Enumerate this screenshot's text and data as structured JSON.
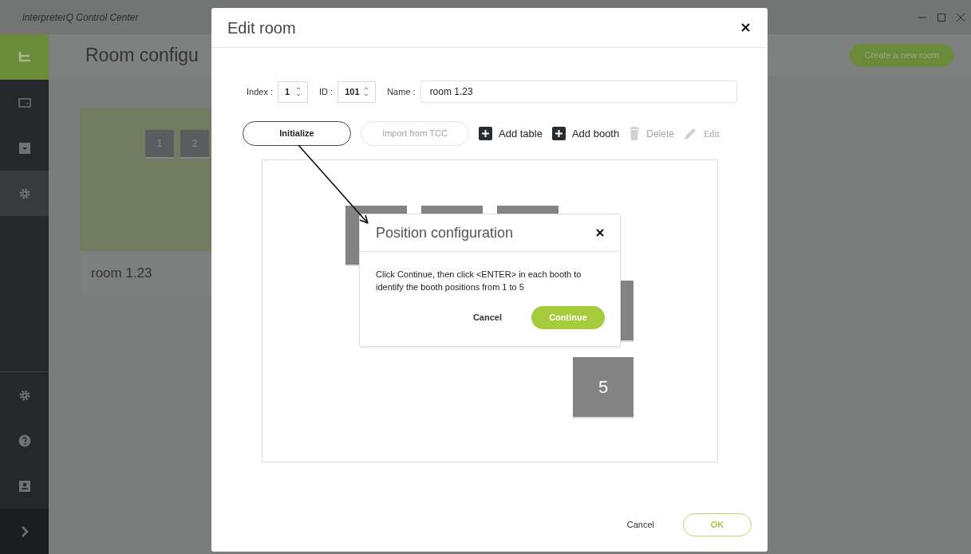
{
  "window": {
    "title": "interpreterQ Control Center"
  },
  "page": {
    "title": "Room configu",
    "create_button": "Create a new room"
  },
  "sidebar": {
    "items": [
      {
        "selected": false
      },
      {
        "selected": false
      },
      {
        "selected": true
      }
    ]
  },
  "room_card": {
    "name": "room 1.23",
    "booths": [
      "1",
      "2"
    ]
  },
  "edit_dialog": {
    "title": "Edit room",
    "index_label": "Index :",
    "index": "1",
    "id_label": "ID :",
    "id": "101",
    "name_label": "Name :",
    "name": "room 1.23",
    "toolbar": [
      {
        "kind": "pill",
        "label": "Initialize",
        "disabled": false
      },
      {
        "kind": "pill",
        "label": "Import from TCC",
        "disabled": true
      },
      {
        "kind": "add",
        "label": "Add table",
        "disabled": false
      },
      {
        "kind": "add",
        "label": "Add booth",
        "disabled": false
      },
      {
        "kind": "delete",
        "label": "Delete",
        "disabled": true
      },
      {
        "kind": "edit",
        "label": "Edit",
        "disabled": true
      }
    ],
    "booths": [
      {
        "label": "5"
      }
    ],
    "cancel": "Cancel",
    "ok": "OK"
  },
  "position_dialog": {
    "title": "Position configuration",
    "message": "Click Continue, then click <ENTER> in each booth to identify the booth positions from 1 to 5",
    "cancel": "Cancel",
    "continue": "Continue"
  }
}
